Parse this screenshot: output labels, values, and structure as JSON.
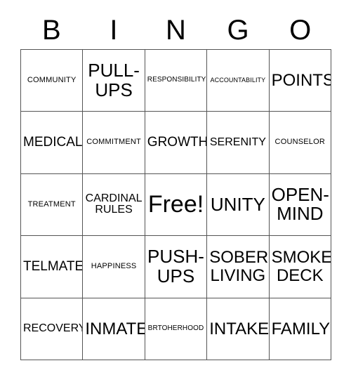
{
  "header": {
    "letters": [
      "B",
      "I",
      "N",
      "G",
      "O"
    ]
  },
  "grid": {
    "rows": [
      [
        {
          "text": "COMMUNITY",
          "size": "fs-md"
        },
        {
          "text": "PULL-\nUPS",
          "size": "fs-4xl"
        },
        {
          "text": "RESPONSIBILITY",
          "size": "fs-sm"
        },
        {
          "text": "ACCOUNTABILITY",
          "size": "fs-xs"
        },
        {
          "text": "POINTS",
          "size": "fs-3xl"
        }
      ],
      [
        {
          "text": "MEDICAL",
          "size": "fs-xl"
        },
        {
          "text": "COMMITMENT",
          "size": "fs-md"
        },
        {
          "text": "GROWTH",
          "size": "fs-xl"
        },
        {
          "text": "SERENITY",
          "size": "fs-lg"
        },
        {
          "text": "COUNSELOR",
          "size": "fs-md"
        }
      ],
      [
        {
          "text": "TREATMENT",
          "size": "fs-md"
        },
        {
          "text": "CARDINAL\nRULES",
          "size": "fs-lg"
        },
        {
          "text": "Free!",
          "size": "fs-5xl"
        },
        {
          "text": "UNITY",
          "size": "fs-4xl"
        },
        {
          "text": "OPEN-\nMIND",
          "size": "fs-4xl"
        }
      ],
      [
        {
          "text": "TELMATE",
          "size": "fs-xl"
        },
        {
          "text": "HAPPINESS",
          "size": "fs-md"
        },
        {
          "text": "PUSH-\nUPS",
          "size": "fs-4xl"
        },
        {
          "text": "SOBER\nLIVING",
          "size": "fs-3xl"
        },
        {
          "text": "SMOKE\nDECK",
          "size": "fs-3xl"
        }
      ],
      [
        {
          "text": "RECOVERY",
          "size": "fs-lg"
        },
        {
          "text": "INMATE",
          "size": "fs-3xl"
        },
        {
          "text": "BRTOHERHOOD",
          "size": "fs-sm"
        },
        {
          "text": "INTAKE",
          "size": "fs-3xl"
        },
        {
          "text": "FAMILY",
          "size": "fs-3xl"
        }
      ]
    ]
  },
  "colors": {
    "border": "#555555",
    "text": "#000000",
    "background": "#ffffff"
  }
}
